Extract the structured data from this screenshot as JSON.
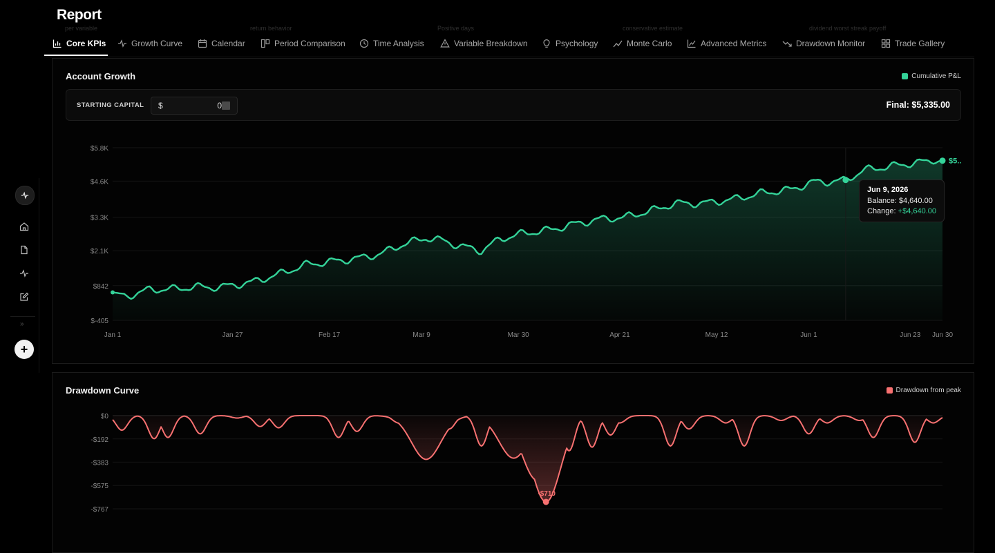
{
  "page": {
    "title": "Report"
  },
  "tabs": [
    {
      "label": "Core KPIs",
      "icon": "bar-chart-icon",
      "active": true
    },
    {
      "label": "Growth Curve",
      "icon": "activity-icon"
    },
    {
      "label": "Calendar",
      "icon": "calendar-icon"
    },
    {
      "label": "Period Comparison",
      "icon": "columns-icon"
    },
    {
      "label": "Time Analysis",
      "icon": "clock-icon"
    },
    {
      "label": "Variable Breakdown",
      "icon": "alert-triangle-icon"
    },
    {
      "label": "Psychology",
      "icon": "lightbulb-icon"
    },
    {
      "label": "Monte Carlo",
      "icon": "line-chart-icon"
    },
    {
      "label": "Advanced Metrics",
      "icon": "area-chart-icon"
    },
    {
      "label": "Drawdown Monitor",
      "icon": "trending-down-icon"
    },
    {
      "label": "Trade Gallery",
      "icon": "grid-icon"
    }
  ],
  "ghost_descriptions": [
    "per variable",
    "return behavior",
    "Positive days",
    "conservative estimate",
    "dividend worst streak payoff"
  ],
  "sidebar": {
    "top_icon": "activity-icon",
    "items": [
      {
        "icon": "home-icon"
      },
      {
        "icon": "file-icon"
      },
      {
        "icon": "activity-icon"
      },
      {
        "icon": "edit-icon"
      }
    ],
    "expand_glyph": "»",
    "add_label": "+"
  },
  "account_growth": {
    "title": "Account Growth",
    "legend": "Cumulative P&L",
    "legend_color": "#34d399",
    "starting_capital_label": "STARTING CAPITAL",
    "currency_symbol": "$",
    "starting_capital_value": "0",
    "final_label": "Final: $5,335.00",
    "end_label": "$5..",
    "tooltip": {
      "date": "Jun 9, 2026",
      "balance_label": "Balance:",
      "balance_value": "$4,640.00",
      "change_label": "Change:",
      "change_value": "+$4,640.00"
    }
  },
  "drawdown": {
    "title": "Drawdown Curve",
    "legend": "Drawdown from peak",
    "legend_color": "#f87171",
    "trough_label": "-$710"
  },
  "chart_data": [
    {
      "type": "area",
      "title": "Account Growth",
      "series": [
        {
          "name": "Cumulative P&L",
          "color": "#34d399"
        }
      ],
      "y_ticks": [
        "$5.8K",
        "$4.6K",
        "$3.3K",
        "$2.1K",
        "$842",
        "$-405"
      ],
      "y_tick_values": [
        5800,
        4600,
        3300,
        2100,
        842,
        -405
      ],
      "x_ticks": [
        "Jan 1",
        "Jan 27",
        "Feb 17",
        "Mar 9",
        "Mar 30",
        "Apr 21",
        "May 12",
        "Jun 1",
        "Jun 23",
        "Jun 30"
      ],
      "x_tick_days": [
        0,
        26,
        47,
        67,
        88,
        110,
        131,
        151,
        173,
        180
      ],
      "ylim": [
        -405,
        5800
      ],
      "keypoints": [
        [
          0,
          600
        ],
        [
          3,
          460
        ],
        [
          8,
          700
        ],
        [
          13,
          720
        ],
        [
          18,
          800
        ],
        [
          23,
          780
        ],
        [
          30,
          960
        ],
        [
          36,
          1250
        ],
        [
          42,
          1600
        ],
        [
          47,
          1700
        ],
        [
          53,
          1820
        ],
        [
          58,
          1980
        ],
        [
          63,
          2330
        ],
        [
          68,
          2560
        ],
        [
          72,
          2450
        ],
        [
          75,
          2280
        ],
        [
          80,
          2100
        ],
        [
          84,
          2520
        ],
        [
          89,
          2720
        ],
        [
          95,
          2850
        ],
        [
          100,
          3050
        ],
        [
          106,
          3240
        ],
        [
          111,
          3300
        ],
        [
          118,
          3590
        ],
        [
          122,
          3800
        ],
        [
          128,
          3800
        ],
        [
          135,
          3960
        ],
        [
          141,
          4180
        ],
        [
          147,
          4290
        ],
        [
          152,
          4570
        ],
        [
          156,
          4580
        ],
        [
          159,
          4640
        ],
        [
          163,
          5000
        ],
        [
          169,
          5140
        ],
        [
          175,
          5280
        ],
        [
          180,
          5335
        ]
      ],
      "tooltip_day": 159,
      "tooltip_value": 4640
    },
    {
      "type": "area",
      "title": "Drawdown Curve",
      "series": [
        {
          "name": "Drawdown from peak",
          "color": "#f87171"
        }
      ],
      "y_ticks": [
        "$0",
        "-$192",
        "-$383",
        "-$575",
        "-$767"
      ],
      "y_tick_values": [
        0,
        -192,
        -383,
        -575,
        -767
      ],
      "ylim": [
        -767,
        0
      ],
      "drawdowns": [
        [
          2,
          120
        ],
        [
          9,
          190
        ],
        [
          12,
          180
        ],
        [
          19,
          150
        ],
        [
          27,
          20
        ],
        [
          32,
          90
        ],
        [
          36,
          100
        ],
        [
          49,
          180
        ],
        [
          53,
          130
        ],
        [
          62,
          60
        ],
        [
          68,
          360
        ],
        [
          73,
          110
        ],
        [
          80,
          250
        ],
        [
          87,
          350
        ],
        [
          92,
          530
        ],
        [
          94,
          710
        ],
        [
          96,
          300
        ],
        [
          99,
          290
        ],
        [
          104,
          260
        ],
        [
          108,
          160
        ],
        [
          110,
          60
        ],
        [
          121,
          250
        ],
        [
          125,
          110
        ],
        [
          133,
          60
        ],
        [
          137,
          250
        ],
        [
          145,
          40
        ],
        [
          151,
          150
        ],
        [
          155,
          60
        ],
        [
          162,
          40
        ],
        [
          165,
          180
        ],
        [
          174,
          220
        ],
        [
          178,
          60
        ]
      ],
      "trough_day": 94,
      "trough_value": -710
    }
  ]
}
